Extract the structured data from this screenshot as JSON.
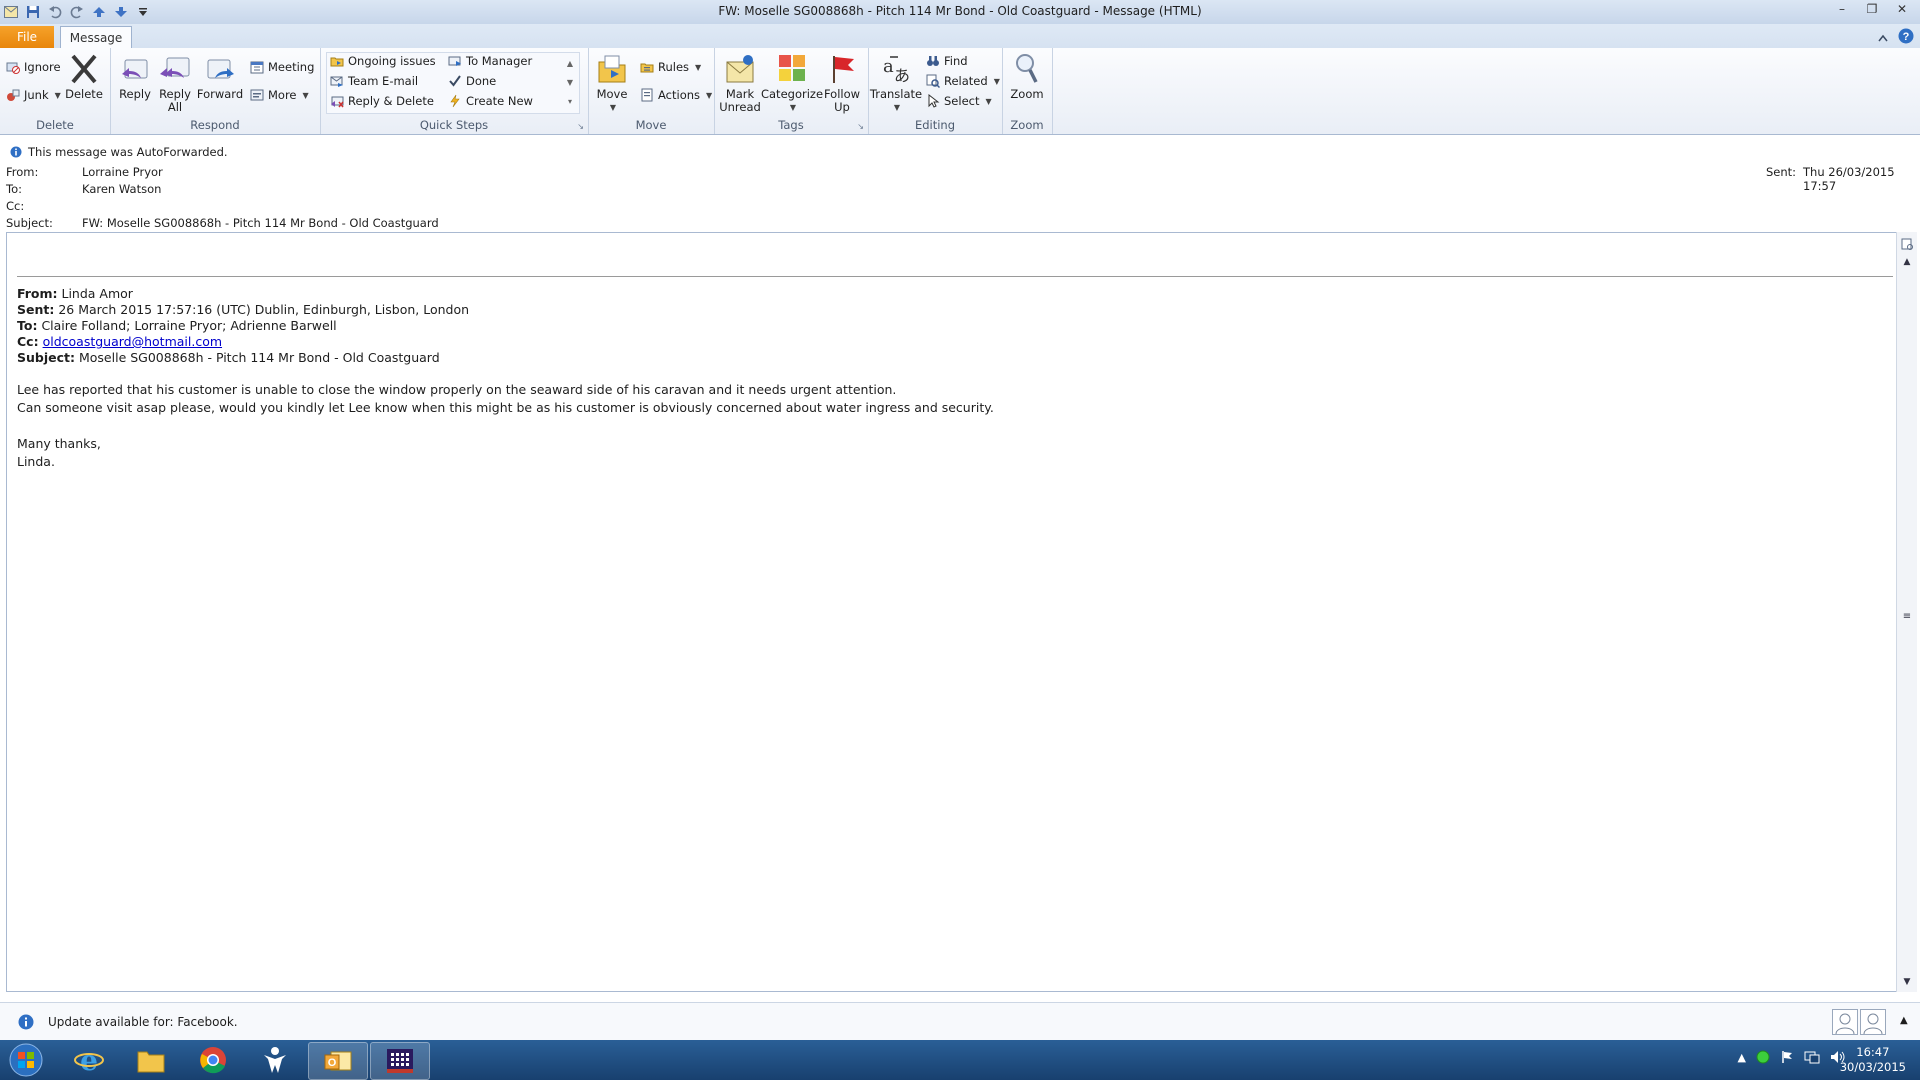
{
  "window": {
    "title": "FW: Moselle SG008868h - Pitch 114 Mr Bond - Old Coastguard - Message (HTML)",
    "controls": [
      "–",
      "❐",
      "✕"
    ]
  },
  "tabs": [
    {
      "label": "File"
    },
    {
      "label": "Message"
    }
  ],
  "ribbon": {
    "delete_group": {
      "label": "Delete",
      "ignore": "Ignore",
      "junk": "Junk",
      "delete": "Delete"
    },
    "respond_group": {
      "label": "Respond",
      "reply": "Reply",
      "reply_all_1": "Reply",
      "reply_all_2": "All",
      "forward": "Forward",
      "meeting": "Meeting",
      "more": "More"
    },
    "quicksteps_group": {
      "label": "Quick Steps",
      "items": [
        "Ongoing issues",
        "Team E-mail",
        "Reply & Delete",
        "To Manager",
        "Done",
        "Create New"
      ]
    },
    "move_group": {
      "label": "Move",
      "move": "Move",
      "rules": "Rules",
      "actions": "Actions"
    },
    "tags_group": {
      "label": "Tags",
      "mark_unread_1": "Mark",
      "mark_unread_2": "Unread",
      "categorize": "Categorize",
      "follow_up_1": "Follow",
      "follow_up_2": "Up"
    },
    "editing_group": {
      "label": "Editing",
      "translate": "Translate",
      "find": "Find",
      "related": "Related",
      "select": "Select"
    },
    "zoom_group": {
      "label": "Zoom",
      "zoom": "Zoom"
    }
  },
  "message_header": {
    "info": "This message was AutoForwarded.",
    "from_label": "From:",
    "from": "Lorraine Pryor",
    "to_label": "To:",
    "to": "Karen Watson",
    "cc_label": "Cc:",
    "cc": "",
    "subject_label": "Subject:",
    "subject": "FW: Moselle SG008868h - Pitch 114 Mr Bond - Old Coastguard",
    "sent_label": "Sent:",
    "sent": "Thu 26/03/2015 17:57"
  },
  "forwarded": {
    "from_label": "From:",
    "from": "Linda Amor",
    "sent_label": "Sent:",
    "sent": "26 March 2015 17:57:16 (UTC) Dublin, Edinburgh, Lisbon, London",
    "to_label": "To:",
    "to": "Claire Folland; Lorraine Pryor; Adrienne Barwell",
    "cc_label": "Cc:",
    "cc": "oldcoastguard@hotmail.com",
    "subject_label": "Subject:",
    "subject": "Moselle SG008868h - Pitch 114 Mr Bond - Old Coastguard"
  },
  "body": {
    "line1": "Lee has reported that his customer is unable to close the window properly on the seaward side of his caravan and it needs urgent attention.",
    "line2": "Can someone visit asap please, would you kindly let Lee know when this might be as his customer is obviously concerned about water ingress and security.",
    "line3": "Many thanks,",
    "line4": "Linda."
  },
  "status": {
    "update": "Update available for: Facebook."
  },
  "taskbar": {
    "time": "16:47",
    "date": "30/03/2015"
  }
}
